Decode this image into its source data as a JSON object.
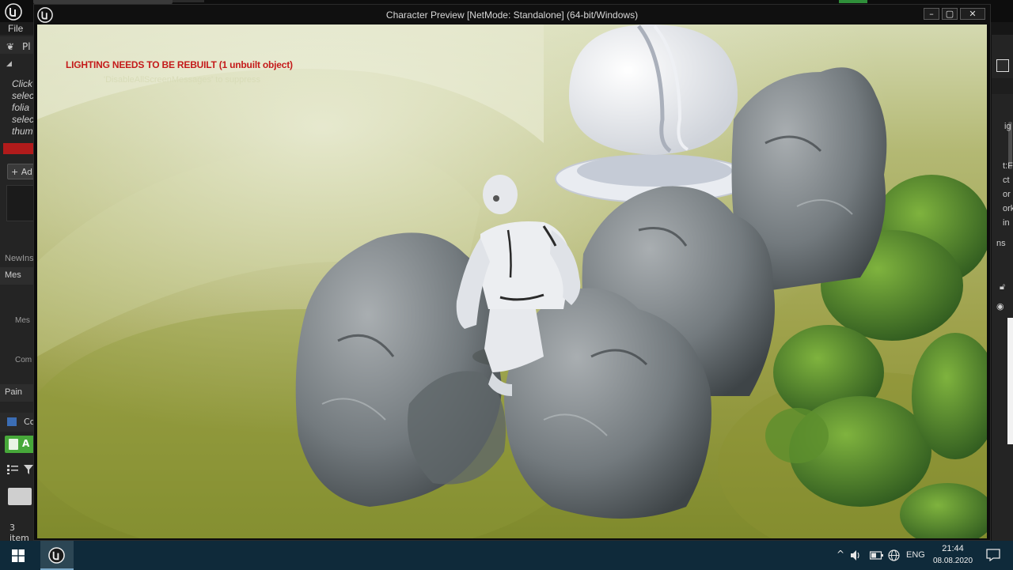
{
  "editor": {
    "menu_file": "File",
    "left_panel": {
      "pl_text": "Pl",
      "hint_lines": [
        "Click",
        "selec",
        "folia",
        "selec",
        "thum"
      ],
      "add_label": "+ Ad",
      "section_newins": "NewIns",
      "section_mes": "Mes",
      "field_mes": "Mes",
      "field_com": "Com",
      "section_pain": "Pain",
      "content_browser_label": "Co",
      "add_new_label": "A",
      "items_count": "3 item"
    },
    "right_panel": {
      "fragments": [
        "ig",
        "t:F",
        "ct",
        "or",
        "ork",
        "in"
      ],
      "bottom_fragment": "ns"
    }
  },
  "window": {
    "title": "Character Preview [NetMode: Standalone]  (64-bit/Windows)",
    "minimize_glyph": "–",
    "maximize_glyph": "▢",
    "close_glyph": "✕"
  },
  "viewport": {
    "warning": "LIGHTING NEEDS TO BE REBUILT (1 unbuilt object)",
    "hint": "'DisableAllScreenMessages' to suppress"
  },
  "taskbar": {
    "language": "ENG",
    "time": "21:44",
    "date": "08.08.2020",
    "tray_chevron": "^",
    "tray_icons": [
      "chevron-up-icon",
      "volume-icon",
      "battery-icon",
      "network-globe-icon"
    ]
  },
  "colors": {
    "warning_red": "#c41a1a",
    "add_new_green": "#47a83a",
    "taskbar_bg": "#0f2a3a"
  }
}
